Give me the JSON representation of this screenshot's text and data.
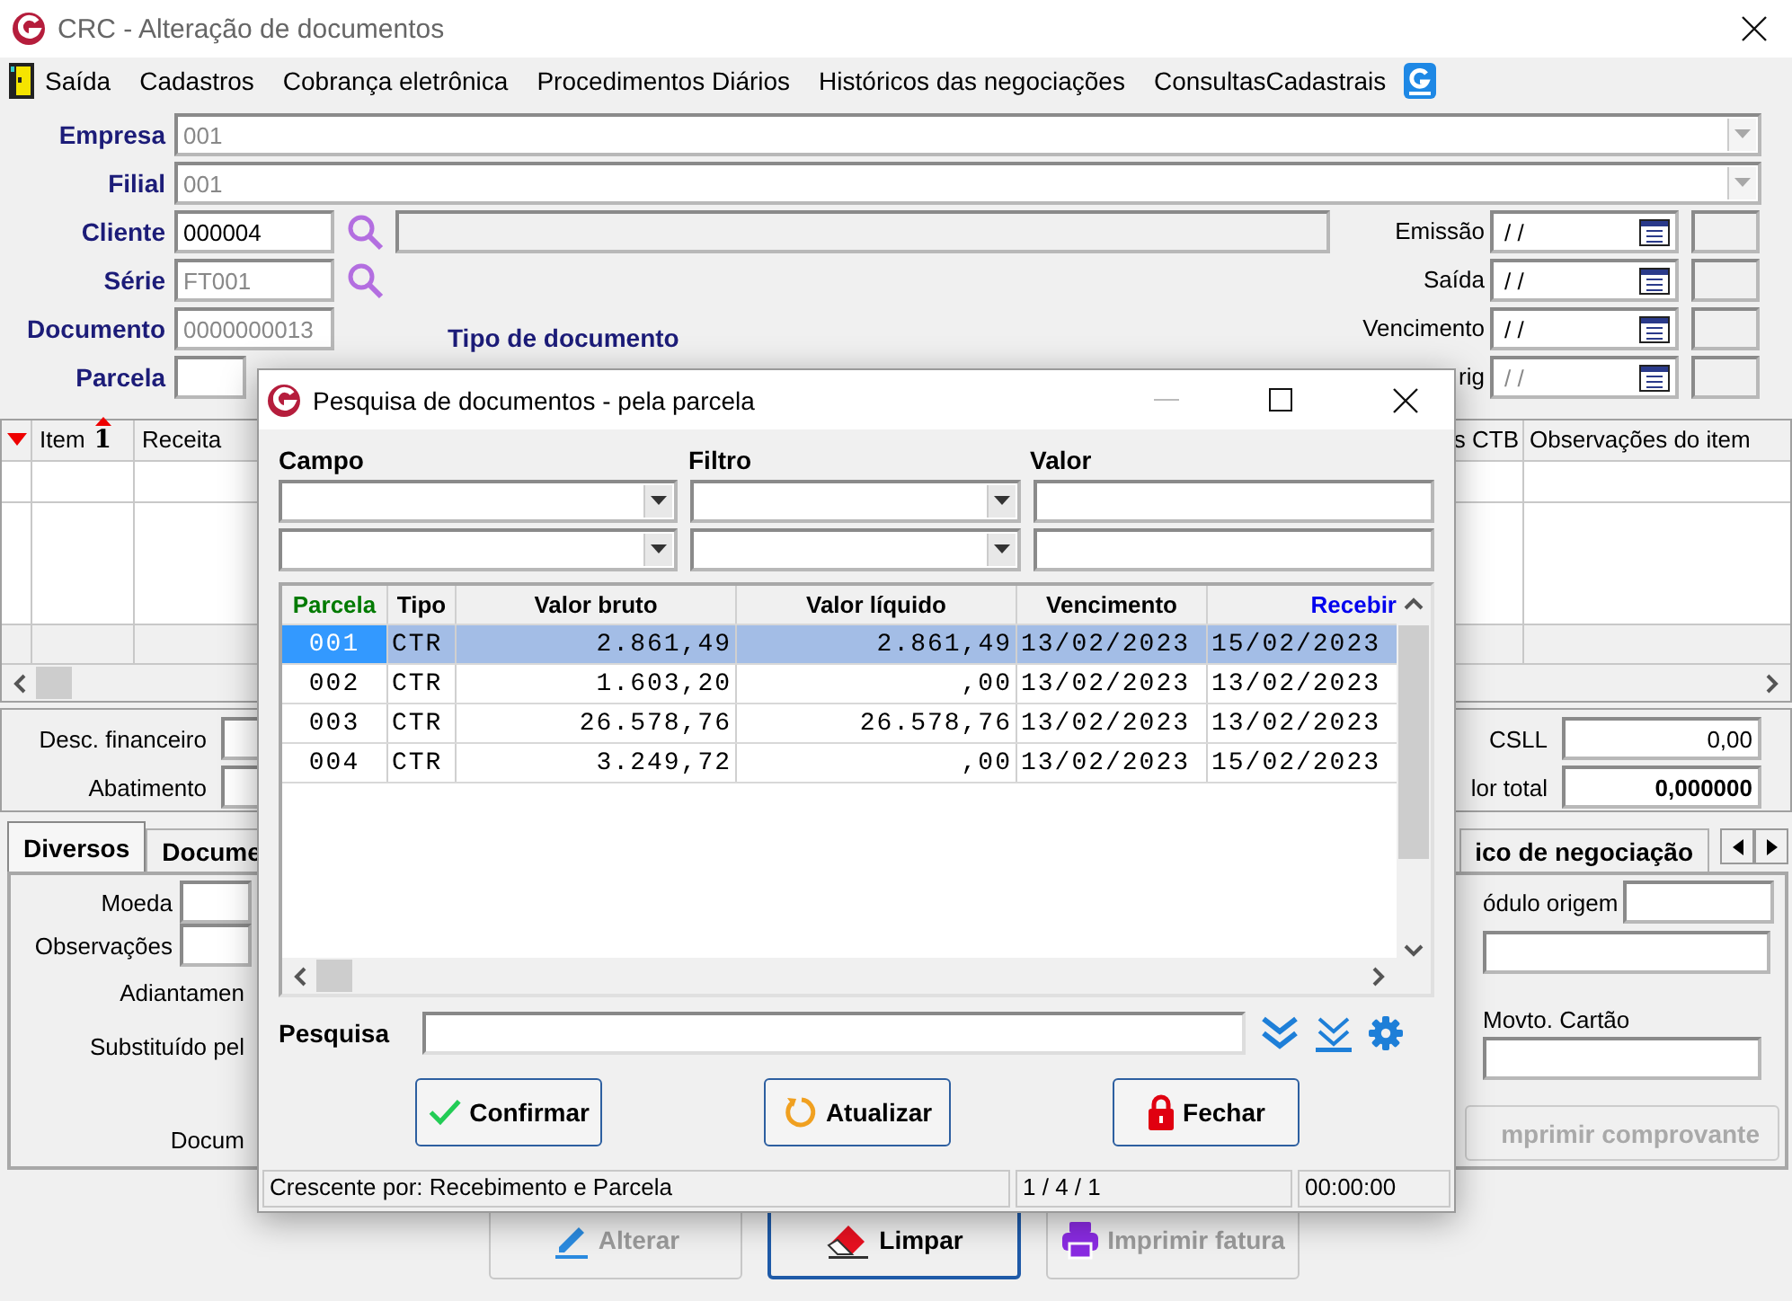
{
  "window": {
    "title": "CRC - Alteração de documentos"
  },
  "menu": [
    {
      "label": "Saída",
      "kind": "exit"
    },
    {
      "label": "Cadastros",
      "kind": "menu"
    },
    {
      "label": "Cobrança eletrônica",
      "kind": "menu"
    },
    {
      "label": "Procedimentos Diários",
      "kind": "menu"
    },
    {
      "label": "Históricos das negociações",
      "kind": "menu"
    },
    {
      "label": "ConsultasCadastrais",
      "kind": "menu"
    },
    {
      "kind": "logo"
    }
  ],
  "header_fields": [
    {
      "label": "Empresa",
      "value": "001",
      "disabled": true
    },
    {
      "label": "Filial",
      "value": "001",
      "disabled": true
    }
  ],
  "left_fields": [
    {
      "label": "Cliente",
      "value": "000004",
      "kind": "lookup",
      "disabled": false
    },
    {
      "label": "Série",
      "value": "FT001",
      "kind": "lookup",
      "disabled": true
    },
    {
      "label": "Documento",
      "value": "0000000013",
      "kind": "text",
      "disabled": true
    },
    {
      "label": "Parcela",
      "kind": "short"
    }
  ],
  "document_type_label": "Tipo de documento",
  "date_fields": [
    {
      "label": "Emissão",
      "value": "/ /",
      "disabled": false
    },
    {
      "label": "Saída",
      "value": "/ /",
      "disabled": false
    },
    {
      "label": "Vencimento",
      "value": "/ /",
      "disabled": false
    },
    {
      "label": "rig",
      "value": "/ /",
      "disabled": true
    }
  ],
  "items_grid": {
    "sort_mark": "1",
    "columns": [
      "Item",
      "Receita",
      "s CTB",
      "Observações do item"
    ]
  },
  "totals": {
    "left": [
      {
        "label": "Desc. financeiro"
      },
      {
        "label": "Abatimento"
      }
    ],
    "right": [
      {
        "label": "CSLL",
        "value": "0,00",
        "bold": false
      },
      {
        "label": "lor total",
        "value": "0,000000",
        "bold": true
      }
    ]
  },
  "tabs": [
    {
      "label": "Diversos",
      "selected": true
    },
    {
      "label": "Docume",
      "selected": false
    },
    {
      "label": "ico de negociação",
      "selected": false
    }
  ],
  "tab_panel": {
    "left": [
      {
        "label": "Moeda",
        "kind": "field"
      },
      {
        "label": "Observações",
        "kind": "field"
      },
      {
        "label": "Adiantamen",
        "kind": "label"
      },
      {
        "label": "Substituído pel",
        "kind": "label"
      },
      {
        "label": "Docum",
        "kind": "label"
      }
    ],
    "module_label": "ódulo origem",
    "card_label": "Movto. Cartão",
    "print_button": {
      "label": "mprimir comprovante",
      "disabled": true
    }
  },
  "actions": [
    {
      "label": "Alterar",
      "disabled": true,
      "focused": false
    },
    {
      "label": "Limpar",
      "disabled": false,
      "focused": true
    },
    {
      "label": "Imprimir fatura",
      "disabled": true,
      "focused": false
    }
  ],
  "dialog": {
    "title": "Pesquisa de documentos - pela parcela",
    "filter_labels": [
      "Campo",
      "Filtro",
      "Valor"
    ],
    "columns": [
      {
        "label": "Parcela",
        "color": "#007a00"
      },
      {
        "label": "Tipo",
        "color": "#000000"
      },
      {
        "label": "Valor bruto",
        "color": "#000000"
      },
      {
        "label": "Valor líquido",
        "color": "#000000"
      },
      {
        "label": "Vencimento",
        "color": "#000000"
      },
      {
        "label": "Recebir",
        "color": "#0000ee"
      }
    ],
    "rows": [
      {
        "cells": [
          "001",
          "CTR",
          "2.861,49",
          "2.861,49",
          "13/02/2023",
          "15/02/2023"
        ],
        "selected": true
      },
      {
        "cells": [
          "002",
          "CTR",
          "1.603,20",
          ",00",
          "13/02/2023",
          "13/02/2023"
        ],
        "selected": false
      },
      {
        "cells": [
          "003",
          "CTR",
          "26.578,76",
          "26.578,76",
          "13/02/2023",
          "13/02/2023"
        ],
        "selected": false
      },
      {
        "cells": [
          "004",
          "CTR",
          "3.249,72",
          ",00",
          "13/02/2023",
          "15/02/2023"
        ],
        "selected": false
      }
    ],
    "search_label": "Pesquisa",
    "buttons": [
      {
        "label": "Confirmar"
      },
      {
        "label": "Atualizar"
      },
      {
        "label": "Fechar"
      }
    ],
    "status": [
      "Crescente por: Recebimento e Parcela",
      "1 / 4 / 1",
      "00:00:00"
    ]
  }
}
